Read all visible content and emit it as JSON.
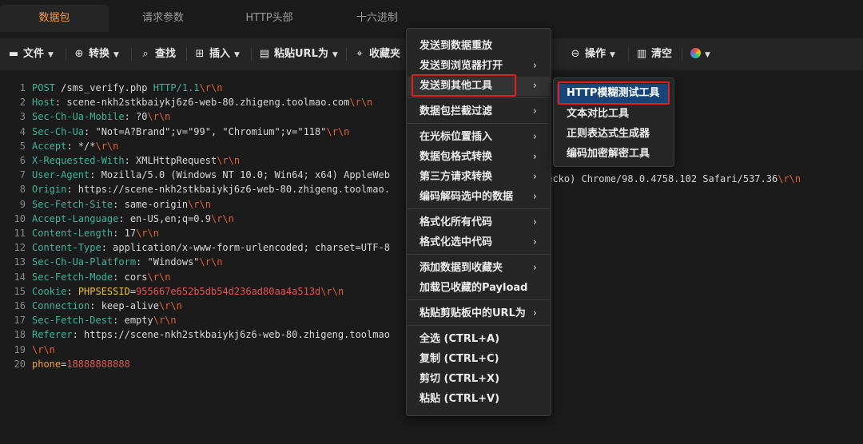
{
  "tabs": [
    "数据包",
    "请求参数",
    "HTTP头部",
    "十六进制"
  ],
  "toolbar": {
    "file": "文件",
    "convert": "转换",
    "find": "查找",
    "insert": "插入",
    "paste_url": "粘贴URL为",
    "favorites": "收藏夹",
    "operation": "操作",
    "clear": "清空"
  },
  "code_lines": [
    {
      "n": "1",
      "parts": [
        [
          "k",
          "POST "
        ],
        [
          "v",
          "/sms_verify.php "
        ],
        [
          "k",
          "HTTP/1.1"
        ],
        [
          "e",
          "\\r\\n"
        ]
      ]
    },
    {
      "n": "2",
      "parts": [
        [
          "k",
          "Host"
        ],
        [
          "v",
          ": scene-nkh2stkbaiykj6z6-web-80.zhigeng.toolmao.com"
        ],
        [
          "e",
          "\\r\\n"
        ]
      ]
    },
    {
      "n": "3",
      "parts": [
        [
          "k",
          "Sec-Ch-Ua-Mobile"
        ],
        [
          "v",
          ": ?0"
        ],
        [
          "e",
          "\\r\\n"
        ]
      ]
    },
    {
      "n": "4",
      "parts": [
        [
          "k",
          "Sec-Ch-Ua"
        ],
        [
          "v",
          ": \"Not=A?Brand\";v=\"99\", \"Chromium\";v=\"118\""
        ],
        [
          "e",
          "\\r\\n"
        ]
      ]
    },
    {
      "n": "5",
      "parts": [
        [
          "k",
          "Accept"
        ],
        [
          "v",
          ": */*"
        ],
        [
          "e",
          "\\r\\n"
        ]
      ]
    },
    {
      "n": "6",
      "parts": [
        [
          "k",
          "X-Requested-With"
        ],
        [
          "v",
          ": XMLHttpRequest"
        ],
        [
          "e",
          "\\r\\n"
        ]
      ]
    },
    {
      "n": "7",
      "parts": [
        [
          "k",
          "User-Agent"
        ],
        [
          "v",
          ": Mozilla/5.0 (Windows NT 10.0; Win64; x64) AppleWeb"
        ]
      ]
    },
    {
      "n": "8",
      "parts": [
        [
          "k",
          "Origin"
        ],
        [
          "v",
          ": https://scene-nkh2stkbaiykj6z6-web-80.zhigeng.toolmao."
        ]
      ]
    },
    {
      "n": "9",
      "parts": [
        [
          "k",
          "Sec-Fetch-Site"
        ],
        [
          "v",
          ": same-origin"
        ],
        [
          "e",
          "\\r\\n"
        ]
      ]
    },
    {
      "n": "10",
      "parts": [
        [
          "k",
          "Accept-Language"
        ],
        [
          "v",
          ": en-US,en;q=0.9"
        ],
        [
          "e",
          "\\r\\n"
        ]
      ]
    },
    {
      "n": "11",
      "parts": [
        [
          "k",
          "Content-Length"
        ],
        [
          "v",
          ": 17"
        ],
        [
          "e",
          "\\r\\n"
        ]
      ]
    },
    {
      "n": "12",
      "parts": [
        [
          "k",
          "Content-Type"
        ],
        [
          "v",
          ": application/x-www-form-urlencoded; charset=UTF-8"
        ]
      ]
    },
    {
      "n": "13",
      "parts": [
        [
          "k",
          "Sec-Ch-Ua-Platform"
        ],
        [
          "v",
          ": \"Windows\""
        ],
        [
          "e",
          "\\r\\n"
        ]
      ]
    },
    {
      "n": "14",
      "parts": [
        [
          "k",
          "Sec-Fetch-Mode"
        ],
        [
          "v",
          ": cors"
        ],
        [
          "e",
          "\\r\\n"
        ]
      ]
    },
    {
      "n": "15",
      "parts": [
        [
          "k",
          "Cookie"
        ],
        [
          "v",
          ": "
        ],
        [
          "yellow",
          "PHPSESSID"
        ],
        [
          "v",
          "="
        ],
        [
          "red",
          "955667e652b5db54d236ad80aa4a513d"
        ],
        [
          "e",
          "\\r\\n"
        ]
      ]
    },
    {
      "n": "16",
      "parts": [
        [
          "k",
          "Connection"
        ],
        [
          "v",
          ": keep-alive"
        ],
        [
          "e",
          "\\r\\n"
        ]
      ]
    },
    {
      "n": "17",
      "parts": [
        [
          "k",
          "Sec-Fetch-Dest"
        ],
        [
          "v",
          ": empty"
        ],
        [
          "e",
          "\\r\\n"
        ]
      ]
    },
    {
      "n": "18",
      "parts": [
        [
          "k",
          "Referer"
        ],
        [
          "v",
          ": https://scene-nkh2stkbaiykj6z6-web-80.zhigeng.toolmao"
        ]
      ]
    },
    {
      "n": "19",
      "parts": [
        [
          "e",
          "\\r\\n"
        ]
      ]
    },
    {
      "n": "20",
      "parts": [
        [
          "orange",
          "phone"
        ],
        [
          "v",
          "="
        ],
        [
          "red",
          "18888888888"
        ]
      ]
    }
  ],
  "ua_tail": "Gecko) Chrome/98.0.4758.102 Safari/537.36",
  "ua_tail_escape": "\\r\\n",
  "context_menu": {
    "items": [
      {
        "label": "发送到数据重放",
        "arrow": false
      },
      {
        "label": "发送到浏览器打开",
        "arrow": true
      },
      {
        "label": "发送到其他工具",
        "arrow": true
      },
      {
        "label": "数据包拦截过滤",
        "arrow": true
      },
      {
        "label": "在光标位置插入",
        "arrow": true
      },
      {
        "label": "数据包格式转换",
        "arrow": true
      },
      {
        "label": "第三方请求转换",
        "arrow": true
      },
      {
        "label": "编码解码选中的数据",
        "arrow": true
      },
      {
        "label": "格式化所有代码",
        "arrow": true
      },
      {
        "label": "格式化选中代码",
        "arrow": true
      },
      {
        "label": "添加数据到收藏夹",
        "arrow": true
      },
      {
        "label": "加载已收藏的Payload",
        "arrow": false
      },
      {
        "label": "粘贴剪贴板中的URL为",
        "arrow": true
      },
      {
        "label": "全选 (CTRL+A)",
        "arrow": false
      },
      {
        "label": "复制 (CTRL+C)",
        "arrow": false
      },
      {
        "label": "剪切 (CTRL+X)",
        "arrow": false
      },
      {
        "label": "粘贴 (CTRL+V)",
        "arrow": false
      }
    ],
    "arrow_glyph": "›"
  },
  "submenu": {
    "items": [
      "HTTP模糊测试工具",
      "文本对比工具",
      "正则表达式生成器",
      "编码加密解密工具"
    ]
  },
  "colors": {
    "accent": "#f39a4a",
    "header_key": "#3fb39c",
    "escape": "#e0603a",
    "highlight_border": "#e02020",
    "submenu_selected": "#17457a"
  }
}
